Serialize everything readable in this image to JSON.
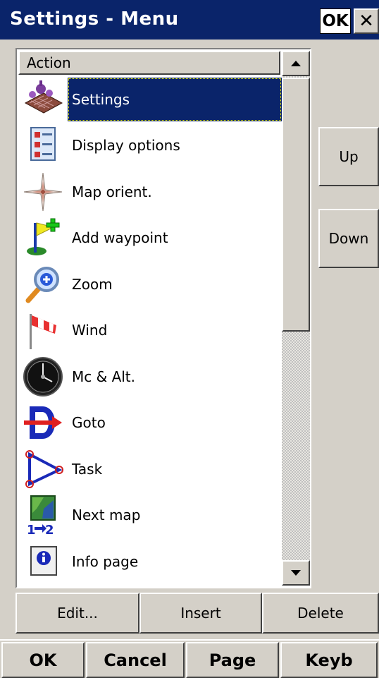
{
  "window": {
    "title": "Settings - Menu",
    "ok_label": "OK",
    "close_label": "✕"
  },
  "list": {
    "column_header": "Action",
    "selected_index": 0,
    "items": [
      {
        "label": "Settings",
        "icon": "settings-icon"
      },
      {
        "label": "Display options",
        "icon": "display-options-icon"
      },
      {
        "label": "Map orient.",
        "icon": "compass-rose-icon"
      },
      {
        "label": "Add waypoint",
        "icon": "add-waypoint-flag-icon"
      },
      {
        "label": "Zoom",
        "icon": "zoom-magnifier-icon"
      },
      {
        "label": "Wind",
        "icon": "windsock-icon"
      },
      {
        "label": "Mc & Alt.",
        "icon": "altimeter-gauge-icon"
      },
      {
        "label": "Goto",
        "icon": "goto-arrow-icon"
      },
      {
        "label": "Task",
        "icon": "task-triangle-icon"
      },
      {
        "label": "Next map",
        "icon": "next-map-icon"
      },
      {
        "label": "Info page",
        "icon": "info-icon"
      }
    ]
  },
  "side_buttons": {
    "up_label": "Up",
    "down_label": "Down"
  },
  "edit_buttons": {
    "edit_label": "Edit...",
    "insert_label": "Insert",
    "delete_label": "Delete"
  },
  "menu_bar": {
    "ok_label": "OK",
    "cancel_label": "Cancel",
    "page_label": "Page",
    "keyb_label": "Keyb"
  },
  "colors": {
    "titlebar": "#0a246a",
    "selection": "#0a246a",
    "face": "#d4d0c8"
  }
}
